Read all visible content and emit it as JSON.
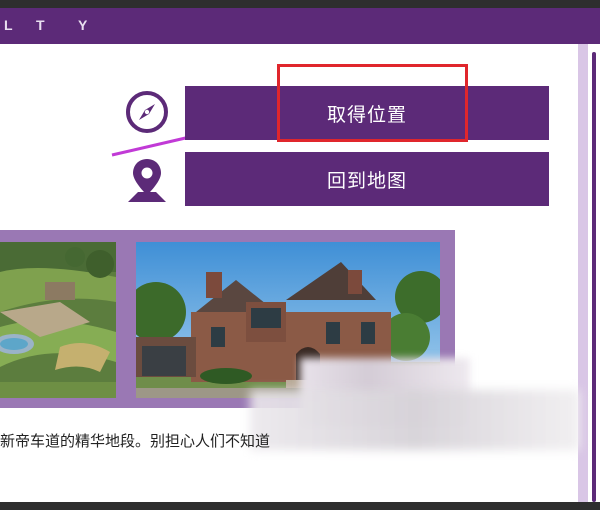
{
  "header": {
    "letters": [
      "L",
      "T",
      "Y"
    ]
  },
  "buttons": {
    "locate": "取得位置",
    "map": "回到地图"
  },
  "icons": {
    "locate": "compass-icon",
    "map": "map-pin-icon",
    "annotation": "arrow-annotation"
  },
  "colors": {
    "primary": "#5c2a78",
    "highlight": "#e0262c",
    "panel": "#9a78b4",
    "arrow": "#c13ad6"
  },
  "caption": "新帝车道的精华地段。别担心人们不知道"
}
